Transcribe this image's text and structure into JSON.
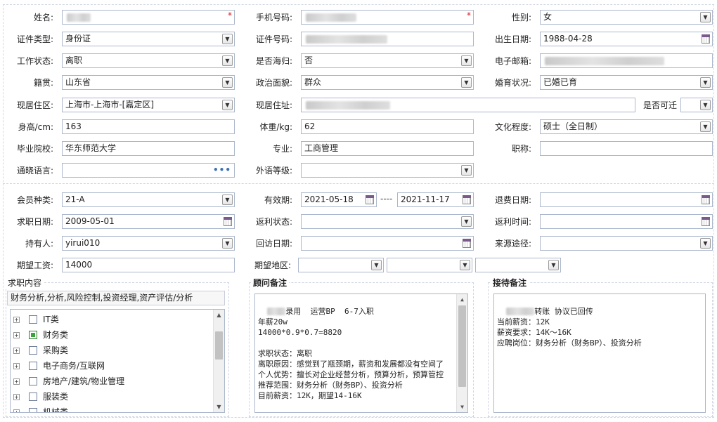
{
  "basic": {
    "name": {
      "label": "姓名:",
      "value": "",
      "required": "*"
    },
    "phone": {
      "label": "手机号码:",
      "value": "",
      "required": "*"
    },
    "gender": {
      "label": "性别:",
      "value": "女"
    },
    "id_type": {
      "label": "证件类型:",
      "value": "身份证"
    },
    "id_number": {
      "label": "证件号码:",
      "value": ""
    },
    "birth_date": {
      "label": "出生日期:",
      "value": "1988-04-28"
    },
    "work_status": {
      "label": "工作状态:",
      "value": "离职"
    },
    "overseas_returnee": {
      "label": "是否海归:",
      "value": "否"
    },
    "email": {
      "label": "电子邮箱:",
      "value": ""
    },
    "native_place": {
      "label": "籍贯:",
      "value": "山东省"
    },
    "political_status": {
      "label": "政治面貌:",
      "value": "群众"
    },
    "marital_status": {
      "label": "婚育状况:",
      "value": "已婚已育"
    },
    "residence_area": {
      "label": "现居住区:",
      "value": "上海市-上海市-[嘉定区]"
    },
    "residence_address": {
      "label": "现居住址:",
      "value": ""
    },
    "can_relocate": {
      "label": "是否可迁",
      "value": ""
    },
    "height": {
      "label": "身高/cm:",
      "value": "163"
    },
    "weight": {
      "label": "体重/kg:",
      "value": "62"
    },
    "education": {
      "label": "文化程度:",
      "value": "硕士（全日制）"
    },
    "school": {
      "label": "毕业院校:",
      "value": "华东师范大学"
    },
    "major": {
      "label": "专业:",
      "value": "工商管理"
    },
    "title": {
      "label": "职称:",
      "value": ""
    },
    "languages": {
      "label": "通晓语言:",
      "value": "",
      "more": "•••"
    },
    "foreign_level": {
      "label": "外语等级:",
      "value": ""
    }
  },
  "membership": {
    "member_type": {
      "label": "会员种类:",
      "value": "21-A"
    },
    "validity": {
      "label": "有效期:",
      "start": "2021-05-18",
      "separator": "----",
      "end": "2021-11-17"
    },
    "refund_date": {
      "label": "退费日期:",
      "value": ""
    },
    "job_search_date": {
      "label": "求职日期:",
      "value": "2009-05-01"
    },
    "rebate_status": {
      "label": "返利状态:",
      "value": ""
    },
    "rebate_time": {
      "label": "返利时间:",
      "value": ""
    },
    "holder": {
      "label": "持有人:",
      "value": "yirui010"
    },
    "followup_date": {
      "label": "回访日期:",
      "value": ""
    },
    "source_channel": {
      "label": "来源途径:",
      "value": ""
    },
    "expected_salary": {
      "label": "期望工资:",
      "value": "14000"
    },
    "expected_region": {
      "label": "期望地区:",
      "values": [
        "",
        "",
        ""
      ]
    }
  },
  "job_content": {
    "legend": "求职内容",
    "summary": "财务分析,分析,风险控制,投资经理,资产评估/分析",
    "tree": [
      {
        "label": "IT类",
        "checked": false
      },
      {
        "label": "财务类",
        "checked": true
      },
      {
        "label": "采购类",
        "checked": false
      },
      {
        "label": "电子商务/互联网",
        "checked": false
      },
      {
        "label": "房地产/建筑/物业管理",
        "checked": false
      },
      {
        "label": "服装类",
        "checked": false
      },
      {
        "label": "机械类",
        "checked": false
      }
    ],
    "scroll_position": 0.2
  },
  "consultant_notes": {
    "legend": "顾问备注",
    "redacted_prefix": "",
    "text": "录用  运营BP  6-7入职\n年薪20w\n14000*0.9*0.7=8820\n\n求职状态：离职\n离职原因：感觉到了瓶颈期，薪资和发展都没有空间了\n个人优势：擅长对企业经营分析，预算分析，预算管控\n推荐范围：财务分析（财务BP）、投资分析\n目前薪资：12K，期望14-16K",
    "scroll_position": 0.0
  },
  "reception_notes": {
    "legend": "接待备注",
    "redacted_prefix": "",
    "text": "转账 协议已回传\n当前薪资：12K\n薪资要求：14K～16K\n应聘岗位：财务分析（财务BP）、投资分析"
  },
  "icons": {
    "dropdown": "▼",
    "scroll_up": "▲",
    "scroll_down": "▼",
    "expand": "+"
  },
  "colors": {
    "required_mark": "#d9232d",
    "border": "#abb7cc",
    "checked": "#3aa33a"
  }
}
